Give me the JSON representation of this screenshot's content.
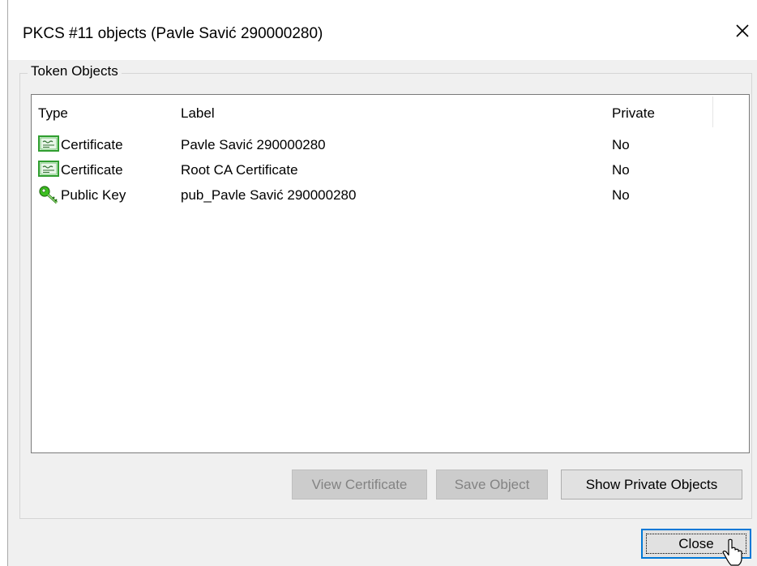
{
  "window": {
    "title": "PKCS #11 objects (Pavle Savić 290000280)"
  },
  "group": {
    "label": "Token Objects"
  },
  "list": {
    "columns": {
      "type": "Type",
      "label": "Label",
      "private": "Private"
    },
    "rows": [
      {
        "type": "Certificate",
        "label": "Pavle Savić 290000280",
        "private": "No",
        "icon": "certificate-icon"
      },
      {
        "type": "Certificate",
        "label": "Root CA Certificate",
        "private": "No",
        "icon": "certificate-icon"
      },
      {
        "type": "Public Key",
        "label": "pub_Pavle Savić 290000280",
        "private": "No",
        "icon": "key-icon"
      }
    ]
  },
  "buttons": {
    "view_certificate": "View Certificate",
    "save_object": "Save Object",
    "show_private_objects": "Show Private Objects",
    "close": "Close"
  },
  "colors": {
    "dialog_bg": "#f0f0f0",
    "focus_border": "#0078d7",
    "cert_icon_green": "#2f9e2f",
    "key_icon_green": "#3cbf1f"
  }
}
